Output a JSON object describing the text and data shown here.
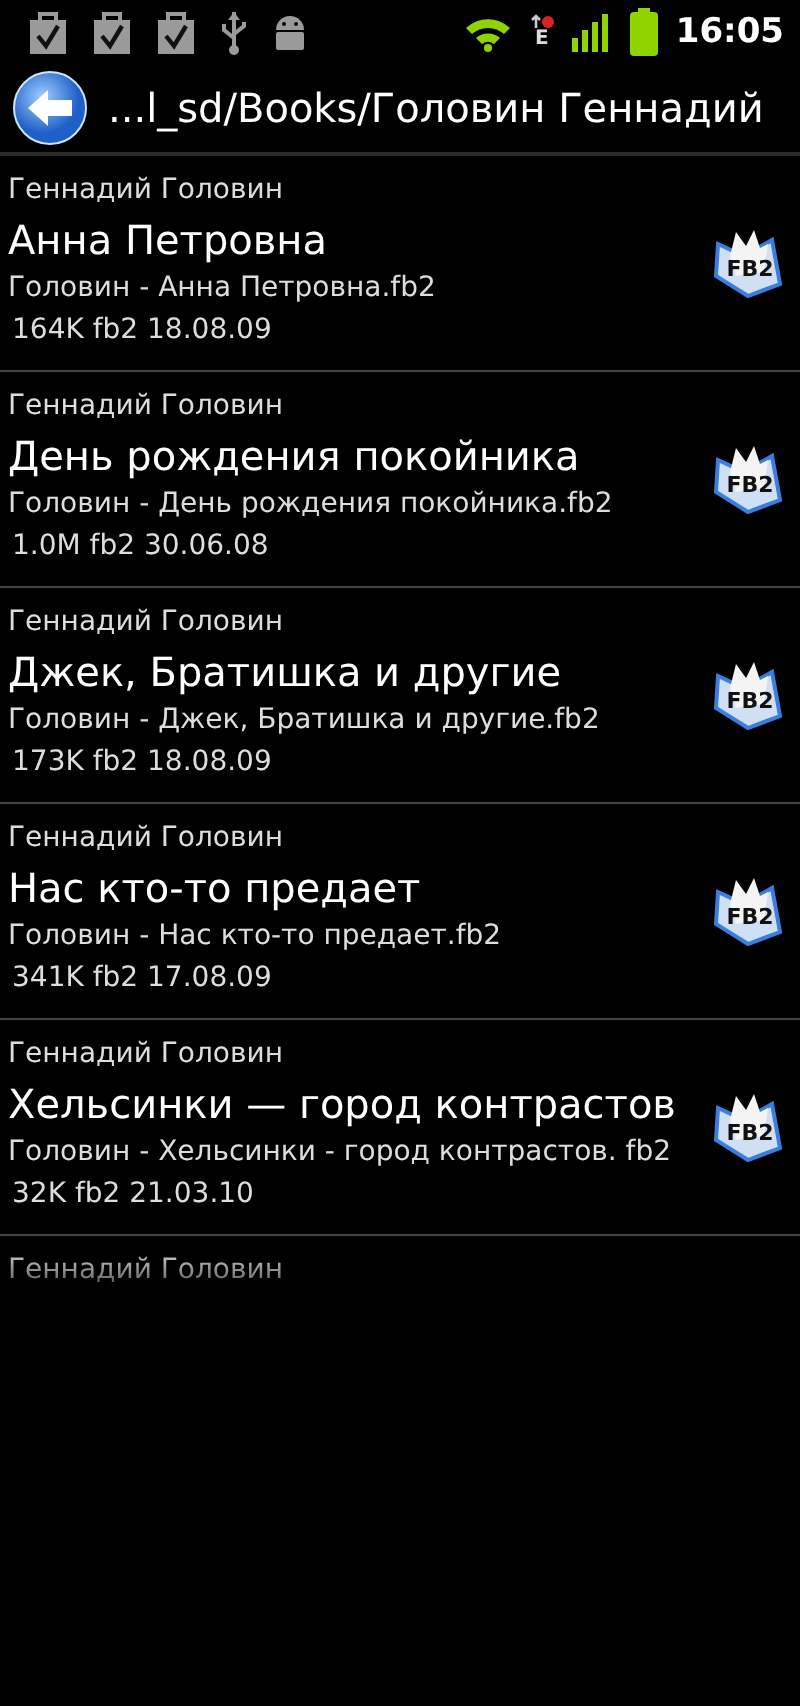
{
  "status_bar": {
    "time": "16:05",
    "network_type": "E"
  },
  "header": {
    "path": "...l_sd/Books/Головин Геннадий"
  },
  "books": [
    {
      "kind": "book",
      "author": "Геннадий  Головин",
      "title": "Анна Петровна",
      "file": "Головин - Анна Петровна.fb2",
      "meta": "164K fb2 18.08.09",
      "icon_label": "FB2"
    },
    {
      "kind": "book",
      "author": "Геннадий  Головин",
      "title": "День рождения покойника",
      "file": "Головин - День рождения покойника.fb2",
      "meta": "1.0M fb2 30.06.08",
      "icon_label": "FB2"
    },
    {
      "kind": "book",
      "author": "Геннадий  Головин",
      "title": "Джек, Братишка и другие",
      "file": "Головин - Джек, Братишка и другие.fb2",
      "meta": "173K fb2 18.08.09",
      "icon_label": "FB2"
    },
    {
      "kind": "book",
      "author": "Геннадий  Головин",
      "title": "Нас кто-то предает",
      "file": "Головин - Нас кто-то предает.fb2",
      "meta": "341K fb2 17.08.09",
      "icon_label": "FB2"
    },
    {
      "kind": "book",
      "author": "Геннадий  Головин",
      "title": "Хельсинки — город контрастов",
      "file": "Головин - Хельсинки - город контрастов. fb2",
      "meta": "32K fb2 21.03.10",
      "icon_label": "FB2"
    },
    {
      "kind": "partial",
      "author": "Геннадий  Головин"
    }
  ]
}
